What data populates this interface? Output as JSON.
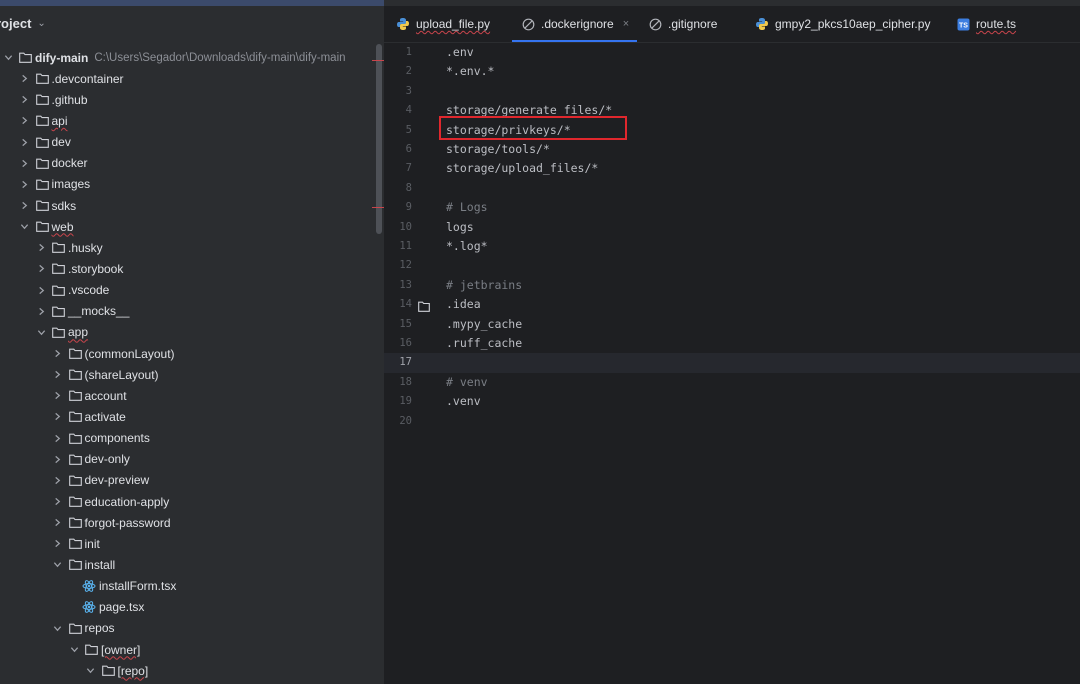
{
  "project_panel": {
    "title": "roject",
    "tree": [
      {
        "label": "dify-main",
        "path": "C:\\Users\\Segador\\Downloads\\dify-main\\dify-main",
        "depth": 0,
        "expanded": true,
        "type": "folder",
        "bold": true
      },
      {
        "label": ".devcontainer",
        "depth": 1,
        "expanded": false,
        "type": "folder"
      },
      {
        "label": ".github",
        "depth": 1,
        "expanded": false,
        "type": "folder"
      },
      {
        "label": "api",
        "depth": 1,
        "expanded": false,
        "type": "folder",
        "error": true
      },
      {
        "label": "dev",
        "depth": 1,
        "expanded": false,
        "type": "folder"
      },
      {
        "label": "docker",
        "depth": 1,
        "expanded": false,
        "type": "folder"
      },
      {
        "label": "images",
        "depth": 1,
        "expanded": false,
        "type": "folder"
      },
      {
        "label": "sdks",
        "depth": 1,
        "expanded": false,
        "type": "folder"
      },
      {
        "label": "web",
        "depth": 1,
        "expanded": true,
        "type": "folder",
        "error": true
      },
      {
        "label": ".husky",
        "depth": 2,
        "expanded": false,
        "type": "folder"
      },
      {
        "label": ".storybook",
        "depth": 2,
        "expanded": false,
        "type": "folder"
      },
      {
        "label": ".vscode",
        "depth": 2,
        "expanded": false,
        "type": "folder"
      },
      {
        "label": "__mocks__",
        "depth": 2,
        "expanded": false,
        "type": "folder"
      },
      {
        "label": "app",
        "depth": 2,
        "expanded": true,
        "type": "folder",
        "error": true
      },
      {
        "label": "(commonLayout)",
        "depth": 3,
        "expanded": false,
        "type": "folder"
      },
      {
        "label": "(shareLayout)",
        "depth": 3,
        "expanded": false,
        "type": "folder"
      },
      {
        "label": "account",
        "depth": 3,
        "expanded": false,
        "type": "folder"
      },
      {
        "label": "activate",
        "depth": 3,
        "expanded": false,
        "type": "folder"
      },
      {
        "label": "components",
        "depth": 3,
        "expanded": false,
        "type": "folder"
      },
      {
        "label": "dev-only",
        "depth": 3,
        "expanded": false,
        "type": "folder"
      },
      {
        "label": "dev-preview",
        "depth": 3,
        "expanded": false,
        "type": "folder"
      },
      {
        "label": "education-apply",
        "depth": 3,
        "expanded": false,
        "type": "folder"
      },
      {
        "label": "forgot-password",
        "depth": 3,
        "expanded": false,
        "type": "folder"
      },
      {
        "label": "init",
        "depth": 3,
        "expanded": false,
        "type": "folder"
      },
      {
        "label": "install",
        "depth": 3,
        "expanded": true,
        "type": "folder"
      },
      {
        "label": "installForm.tsx",
        "depth": 4,
        "type": "file-react"
      },
      {
        "label": "page.tsx",
        "depth": 4,
        "type": "file-react"
      },
      {
        "label": "repos",
        "depth": 3,
        "expanded": true,
        "type": "folder"
      },
      {
        "label": "[owner]",
        "depth": 4,
        "expanded": true,
        "type": "folder",
        "error": true
      },
      {
        "label": "[repo]",
        "depth": 5,
        "expanded": true,
        "type": "folder",
        "error": true
      }
    ]
  },
  "editor": {
    "tabs": [
      {
        "label": "upload_file.py",
        "icon": "python-icon",
        "active": false,
        "error": true
      },
      {
        "label": ".dockerignore",
        "icon": "ignore-file-icon",
        "active": true,
        "closable": true,
        "close_label": "×"
      },
      {
        "label": ".gitignore",
        "icon": "ignore-file-icon",
        "active": false
      },
      {
        "label": "gmpy2_pkcs10aep_cipher.py",
        "icon": "python-icon",
        "active": false
      },
      {
        "label": "route.ts",
        "icon": "typescript-icon",
        "ts_badge": "TS",
        "active": false,
        "error": true
      }
    ],
    "lines": [
      {
        "num": "1",
        "text": ".env"
      },
      {
        "num": "2",
        "text": "*.env.*"
      },
      {
        "num": "3",
        "text": ""
      },
      {
        "num": "4",
        "text": "storage/generate_files/*"
      },
      {
        "num": "5",
        "text": "storage/privkeys/*",
        "highlighted": true
      },
      {
        "num": "6",
        "text": "storage/tools/*"
      },
      {
        "num": "7",
        "text": "storage/upload_files/*"
      },
      {
        "num": "8",
        "text": ""
      },
      {
        "num": "9",
        "text": "# Logs",
        "comment": true
      },
      {
        "num": "10",
        "text": "logs"
      },
      {
        "num": "11",
        "text": "*.log*"
      },
      {
        "num": "12",
        "text": ""
      },
      {
        "num": "13",
        "text": "# jetbrains",
        "comment": true
      },
      {
        "num": "14",
        "text": ".idea",
        "folder_marker": true
      },
      {
        "num": "15",
        "text": ".mypy_cache"
      },
      {
        "num": "16",
        "text": ".ruff_cache"
      },
      {
        "num": "17",
        "text": "",
        "current": true
      },
      {
        "num": "18",
        "text": "# venv",
        "comment": true
      },
      {
        "num": "19",
        "text": ".venv"
      },
      {
        "num": "20",
        "text": ""
      }
    ]
  }
}
